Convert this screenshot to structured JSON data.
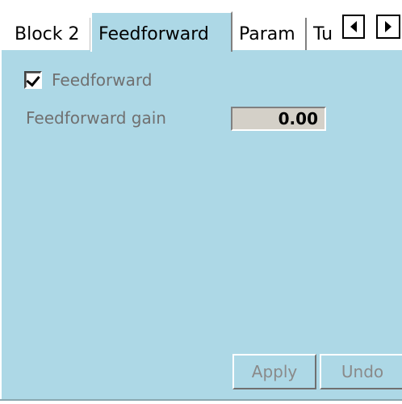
{
  "tabs": [
    {
      "label": "Block 2"
    },
    {
      "label": "Feedforward"
    },
    {
      "label": "Param"
    },
    {
      "label": "Tu"
    }
  ],
  "active_tab": "Feedforward",
  "feedforward": {
    "checkbox_label": "Feedforward",
    "checked": true,
    "gain_label": "Feedforward gain",
    "gain_value": "0.00"
  },
  "buttons": {
    "apply": "Apply",
    "undo": "Undo"
  },
  "colors": {
    "panel_bg": "#add8e6",
    "disabled_text": "#8a8a8a"
  }
}
